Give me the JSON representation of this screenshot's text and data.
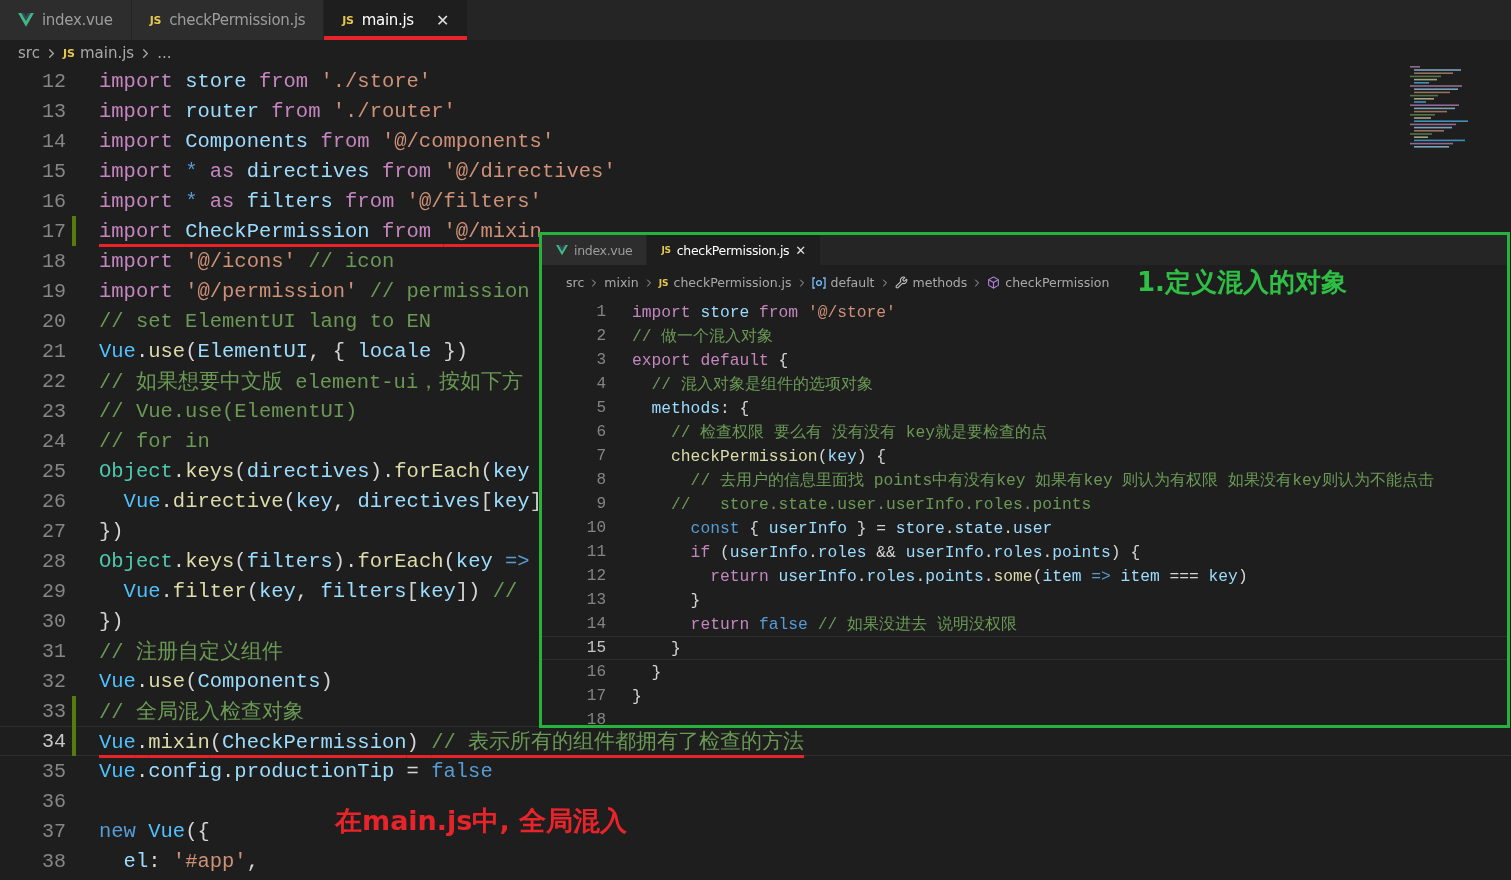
{
  "tabs": [
    {
      "label": "index.vue",
      "kind": "vue",
      "selected": false,
      "closable": false,
      "annotated": false
    },
    {
      "label": "checkPermission.js",
      "kind": "js",
      "icon_text": "JS",
      "selected": false,
      "closable": false,
      "annotated": false
    },
    {
      "label": "main.js",
      "kind": "js",
      "icon_text": "JS",
      "selected": true,
      "closable": true,
      "close_glyph": "✕",
      "annotated": true
    }
  ],
  "breadcrumb": [
    {
      "label": "src"
    },
    {
      "label": "main.js",
      "kind": "js",
      "icon_text": "JS"
    },
    {
      "label": "..."
    }
  ],
  "code_lines": [
    {
      "number": "12",
      "tokens": [
        {
          "text": "import ",
          "kind": "kw"
        },
        {
          "text": "store ",
          "kind": "v"
        },
        {
          "text": "from ",
          "kind": "kw"
        },
        {
          "text": "'./store'",
          "kind": "s"
        }
      ]
    },
    {
      "number": "13",
      "tokens": [
        {
          "text": "import ",
          "kind": "kw"
        },
        {
          "text": "router ",
          "kind": "v"
        },
        {
          "text": "from ",
          "kind": "kw"
        },
        {
          "text": "'./router'",
          "kind": "s"
        }
      ]
    },
    {
      "number": "14",
      "tokens": [
        {
          "text": "import ",
          "kind": "kw"
        },
        {
          "text": "Components ",
          "kind": "v"
        },
        {
          "text": "from ",
          "kind": "kw"
        },
        {
          "text": "'@/components'",
          "kind": "s"
        }
      ]
    },
    {
      "number": "15",
      "tokens": [
        {
          "text": "import ",
          "kind": "kw"
        },
        {
          "text": "* ",
          "kind": "st"
        },
        {
          "text": "as ",
          "kind": "kw"
        },
        {
          "text": "directives ",
          "kind": "v"
        },
        {
          "text": "from ",
          "kind": "kw"
        },
        {
          "text": "'@/directives'",
          "kind": "s"
        }
      ]
    },
    {
      "number": "16",
      "tokens": [
        {
          "text": "import ",
          "kind": "kw"
        },
        {
          "text": "* ",
          "kind": "st"
        },
        {
          "text": "as ",
          "kind": "kw"
        },
        {
          "text": "filters ",
          "kind": "v"
        },
        {
          "text": "from ",
          "kind": "kw"
        },
        {
          "text": "'@/filters'",
          "kind": "s"
        }
      ]
    },
    {
      "number": "17",
      "modified": true,
      "underlined": true,
      "tokens": [
        {
          "text": "import ",
          "kind": "kw"
        },
        {
          "text": "CheckPermission ",
          "kind": "v"
        },
        {
          "text": "from ",
          "kind": "kw"
        },
        {
          "text": "'@/mixin",
          "kind": "s"
        }
      ]
    },
    {
      "number": "18",
      "tokens": [
        {
          "text": "import ",
          "kind": "kw"
        },
        {
          "text": "'@/icons' ",
          "kind": "s"
        },
        {
          "text": "// icon",
          "kind": "c"
        }
      ]
    },
    {
      "number": "19",
      "tokens": [
        {
          "text": "import ",
          "kind": "kw"
        },
        {
          "text": "'@/permission' ",
          "kind": "s"
        },
        {
          "text": "// permission",
          "kind": "c"
        }
      ]
    },
    {
      "number": "20",
      "tokens": [
        {
          "text": "// set ElementUI lang to EN",
          "kind": "c"
        }
      ]
    },
    {
      "number": "21",
      "tokens": [
        {
          "text": "Vue",
          "kind": "k"
        },
        {
          "text": ".",
          "kind": "p"
        },
        {
          "text": "use",
          "kind": "f"
        },
        {
          "text": "(",
          "kind": "p"
        },
        {
          "text": "ElementUI",
          "kind": "v"
        },
        {
          "text": ", { ",
          "kind": "p"
        },
        {
          "text": "locale",
          "kind": "v"
        },
        {
          "text": " })",
          "kind": "p"
        }
      ]
    },
    {
      "number": "22",
      "tokens": [
        {
          "text": "// 如果想要中文版 element-ui，按如下方",
          "kind": "c"
        }
      ]
    },
    {
      "number": "23",
      "tokens": [
        {
          "text": "// Vue.use(ElementUI)",
          "kind": "c"
        }
      ]
    },
    {
      "number": "24",
      "tokens": [
        {
          "text": "// for in",
          "kind": "c"
        }
      ]
    },
    {
      "number": "25",
      "tokens": [
        {
          "text": "Object",
          "kind": "t"
        },
        {
          "text": ".",
          "kind": "p"
        },
        {
          "text": "keys",
          "kind": "f"
        },
        {
          "text": "(",
          "kind": "p"
        },
        {
          "text": "directives",
          "kind": "v"
        },
        {
          "text": ").",
          "kind": "p"
        },
        {
          "text": "forEach",
          "kind": "f"
        },
        {
          "text": "(",
          "kind": "p"
        },
        {
          "text": "key",
          "kind": "v"
        }
      ]
    },
    {
      "number": "26",
      "tokens": [
        {
          "text": "  Vue",
          "kind": "k"
        },
        {
          "text": ".",
          "kind": "p"
        },
        {
          "text": "directive",
          "kind": "f"
        },
        {
          "text": "(",
          "kind": "p"
        },
        {
          "text": "key",
          "kind": "v"
        },
        {
          "text": ", ",
          "kind": "p"
        },
        {
          "text": "directives",
          "kind": "v"
        },
        {
          "text": "[",
          "kind": "p"
        },
        {
          "text": "key",
          "kind": "v"
        },
        {
          "text": "]",
          "kind": "p"
        }
      ]
    },
    {
      "number": "27",
      "tokens": [
        {
          "text": "})",
          "kind": "p"
        }
      ]
    },
    {
      "number": "28",
      "tokens": [
        {
          "text": "Object",
          "kind": "t"
        },
        {
          "text": ".",
          "kind": "p"
        },
        {
          "text": "keys",
          "kind": "f"
        },
        {
          "text": "(",
          "kind": "p"
        },
        {
          "text": "filters",
          "kind": "v"
        },
        {
          "text": ").",
          "kind": "p"
        },
        {
          "text": "forEach",
          "kind": "f"
        },
        {
          "text": "(",
          "kind": "p"
        },
        {
          "text": "key ",
          "kind": "v"
        },
        {
          "text": "=>",
          "kind": "st"
        }
      ]
    },
    {
      "number": "29",
      "tokens": [
        {
          "text": "  Vue",
          "kind": "k"
        },
        {
          "text": ".",
          "kind": "p"
        },
        {
          "text": "filter",
          "kind": "f"
        },
        {
          "text": "(",
          "kind": "p"
        },
        {
          "text": "key",
          "kind": "v"
        },
        {
          "text": ", ",
          "kind": "p"
        },
        {
          "text": "filters",
          "kind": "v"
        },
        {
          "text": "[",
          "kind": "p"
        },
        {
          "text": "key",
          "kind": "v"
        },
        {
          "text": "]) ",
          "kind": "p"
        },
        {
          "text": "//",
          "kind": "c"
        }
      ]
    },
    {
      "number": "30",
      "tokens": [
        {
          "text": "})",
          "kind": "p"
        }
      ]
    },
    {
      "number": "31",
      "tokens": [
        {
          "text": "// 注册自定义组件",
          "kind": "c"
        }
      ]
    },
    {
      "number": "32",
      "tokens": [
        {
          "text": "Vue",
          "kind": "k"
        },
        {
          "text": ".",
          "kind": "p"
        },
        {
          "text": "use",
          "kind": "f"
        },
        {
          "text": "(",
          "kind": "p"
        },
        {
          "text": "Components",
          "kind": "v"
        },
        {
          "text": ")",
          "kind": "p"
        }
      ]
    },
    {
      "number": "33",
      "modified": true,
      "tokens": [
        {
          "text": "// 全局混入检查对象",
          "kind": "c"
        }
      ]
    },
    {
      "number": "34",
      "modified": true,
      "underlined": true,
      "current": true,
      "tokens": [
        {
          "text": "Vue",
          "kind": "k"
        },
        {
          "text": ".",
          "kind": "p"
        },
        {
          "text": "mixin",
          "kind": "f"
        },
        {
          "text": "(",
          "kind": "p"
        },
        {
          "text": "CheckPermission",
          "kind": "v"
        },
        {
          "text": ") ",
          "kind": "p"
        },
        {
          "text": "// 表示所有的组件都拥有了检查的方法",
          "kind": "c"
        }
      ]
    },
    {
      "number": "35",
      "tokens": [
        {
          "text": "Vue",
          "kind": "k"
        },
        {
          "text": ".",
          "kind": "p"
        },
        {
          "text": "config",
          "kind": "v"
        },
        {
          "text": ".",
          "kind": "p"
        },
        {
          "text": "productionTip",
          "kind": "v"
        },
        {
          "text": " = ",
          "kind": "p"
        },
        {
          "text": "false",
          "kind": "st"
        }
      ]
    },
    {
      "number": "36"
    },
    {
      "number": "37",
      "tokens": [
        {
          "text": "new ",
          "kind": "st"
        },
        {
          "text": "Vue",
          "kind": "k"
        },
        {
          "text": "({",
          "kind": "p"
        }
      ]
    },
    {
      "number": "38",
      "tokens": [
        {
          "text": "  el",
          "kind": "v"
        },
        {
          "text": ": ",
          "kind": "p"
        },
        {
          "text": "'#app'",
          "kind": "s"
        },
        {
          "text": ",",
          "kind": "p"
        }
      ]
    }
  ],
  "annotation": "在main.js中, 全局混入",
  "inset": {
    "tabs": [
      {
        "label": "index.vue",
        "kind": "vue",
        "selected": false,
        "closable": false
      },
      {
        "label": "checkPermission.js",
        "kind": "js",
        "icon_text": "JS",
        "selected": true,
        "closable": true,
        "close_glyph": "✕"
      }
    ],
    "breadcrumb": [
      {
        "label": "src"
      },
      {
        "label": "mixin"
      },
      {
        "label": "checkPermission.js",
        "kind": "js",
        "icon_text": "JS"
      },
      {
        "label": "default",
        "kind": "object"
      },
      {
        "label": "methods",
        "kind": "wrench"
      },
      {
        "label": "checkPermission",
        "kind": "cube"
      }
    ],
    "annotation": "1.定义混入的对象",
    "code_lines": [
      {
        "number": "1",
        "tokens": [
          {
            "text": "import ",
            "kind": "kw"
          },
          {
            "text": "store ",
            "kind": "v"
          },
          {
            "text": "from ",
            "kind": "kw"
          },
          {
            "text": "'@/store'",
            "kind": "s"
          }
        ]
      },
      {
        "number": "2",
        "tokens": [
          {
            "text": "// 做一个混入对象",
            "kind": "c"
          }
        ]
      },
      {
        "number": "3",
        "tokens": [
          {
            "text": "export ",
            "kind": "kw"
          },
          {
            "text": "default ",
            "kind": "kw"
          },
          {
            "text": "{",
            "kind": "p"
          }
        ]
      },
      {
        "number": "4",
        "tokens": [
          {
            "text": "  // 混入对象是组件的选项对象",
            "kind": "c"
          }
        ]
      },
      {
        "number": "5",
        "tokens": [
          {
            "text": "  methods",
            "kind": "v"
          },
          {
            "text": ": {",
            "kind": "p"
          }
        ]
      },
      {
        "number": "6",
        "tokens": [
          {
            "text": "    // 检查权限 要么有 没有没有 key就是要检查的点",
            "kind": "c"
          }
        ]
      },
      {
        "number": "7",
        "tokens": [
          {
            "text": "    checkPermission",
            "kind": "f"
          },
          {
            "text": "(",
            "kind": "p"
          },
          {
            "text": "key",
            "kind": "v"
          },
          {
            "text": ") {",
            "kind": "p"
          }
        ]
      },
      {
        "number": "8",
        "tokens": [
          {
            "text": "      // 去用户的信息里面找 points中有没有key 如果有key 则认为有权限 如果没有key则认为不能点击",
            "kind": "c"
          }
        ]
      },
      {
        "number": "9",
        "tokens": [
          {
            "text": "    //   store.state.user.userInfo.roles.points",
            "kind": "c"
          }
        ]
      },
      {
        "number": "10",
        "tokens": [
          {
            "text": "      const ",
            "kind": "st"
          },
          {
            "text": "{ ",
            "kind": "p"
          },
          {
            "text": "userInfo",
            "kind": "v"
          },
          {
            "text": " } = ",
            "kind": "p"
          },
          {
            "text": "store",
            "kind": "v"
          },
          {
            "text": ".",
            "kind": "p"
          },
          {
            "text": "state",
            "kind": "v"
          },
          {
            "text": ".",
            "kind": "p"
          },
          {
            "text": "user",
            "kind": "v"
          }
        ]
      },
      {
        "number": "11",
        "tokens": [
          {
            "text": "      if ",
            "kind": "kw"
          },
          {
            "text": "(",
            "kind": "p"
          },
          {
            "text": "userInfo",
            "kind": "v"
          },
          {
            "text": ".",
            "kind": "p"
          },
          {
            "text": "roles",
            "kind": "v"
          },
          {
            "text": " && ",
            "kind": "p"
          },
          {
            "text": "userInfo",
            "kind": "v"
          },
          {
            "text": ".",
            "kind": "p"
          },
          {
            "text": "roles",
            "kind": "v"
          },
          {
            "text": ".",
            "kind": "p"
          },
          {
            "text": "points",
            "kind": "v"
          },
          {
            "text": ") {",
            "kind": "p"
          }
        ]
      },
      {
        "number": "12",
        "tokens": [
          {
            "text": "        return ",
            "kind": "kw"
          },
          {
            "text": "userInfo",
            "kind": "v"
          },
          {
            "text": ".",
            "kind": "p"
          },
          {
            "text": "roles",
            "kind": "v"
          },
          {
            "text": ".",
            "kind": "p"
          },
          {
            "text": "points",
            "kind": "v"
          },
          {
            "text": ".",
            "kind": "p"
          },
          {
            "text": "some",
            "kind": "f"
          },
          {
            "text": "(",
            "kind": "p"
          },
          {
            "text": "item ",
            "kind": "v"
          },
          {
            "text": "=> ",
            "kind": "st"
          },
          {
            "text": "item",
            "kind": "v"
          },
          {
            "text": " === ",
            "kind": "p"
          },
          {
            "text": "key",
            "kind": "v"
          },
          {
            "text": ")",
            "kind": "p"
          }
        ]
      },
      {
        "number": "13",
        "tokens": [
          {
            "text": "      }",
            "kind": "p"
          }
        ]
      },
      {
        "number": "14",
        "tokens": [
          {
            "text": "      return ",
            "kind": "kw"
          },
          {
            "text": "false ",
            "kind": "st"
          },
          {
            "text": "// 如果没进去 说明没权限",
            "kind": "c"
          }
        ]
      },
      {
        "number": "15",
        "current": true,
        "tokens": [
          {
            "text": "    }",
            "kind": "p"
          }
        ]
      },
      {
        "number": "16",
        "tokens": [
          {
            "text": "  }",
            "kind": "p"
          }
        ]
      },
      {
        "number": "17",
        "tokens": [
          {
            "text": "}",
            "kind": "p"
          }
        ]
      },
      {
        "number": "18"
      }
    ]
  }
}
